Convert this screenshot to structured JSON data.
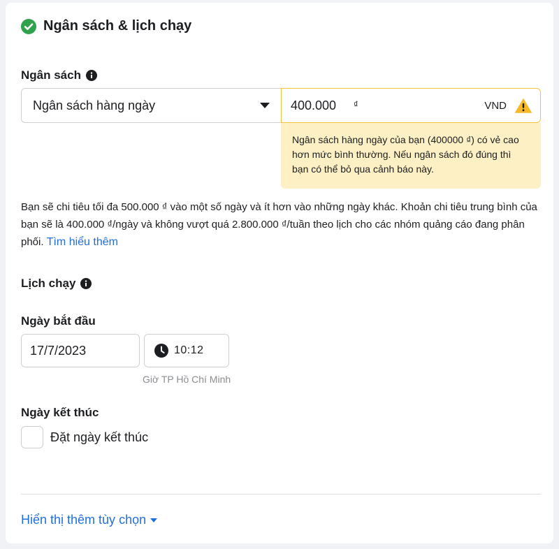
{
  "header": {
    "title": "Ngân sách & lịch chạy"
  },
  "budget": {
    "label": "Ngân sách",
    "type_selected": "Ngân sách hàng ngày",
    "amount_value": "400.000",
    "currency_symbol": "₫",
    "currency_code": "VND",
    "warning_text": "Ngân sách hàng ngày của bạn (400000 ₫) có vẻ cao hơn mức bình thường. Nếu ngân sách đó đúng thì bạn có thể bỏ qua cảnh báo này.",
    "description": "Bạn sẽ chi tiêu tối đa 500.000 ₫ vào một số ngày và ít hơn vào những ngày khác. Khoản chi tiêu trung bình của bạn sẽ là 400.000 ₫/ngày và không vượt quá 2.800.000 ₫/tuần theo lịch cho các nhóm quảng cáo đang phân phối.",
    "learn_more": "Tìm hiểu thêm"
  },
  "schedule": {
    "label": "Lịch chạy",
    "start_label": "Ngày bắt đầu",
    "start_date": "17/7/2023",
    "start_time": "10:12",
    "timezone": "Giờ TP Hồ Chí Minh",
    "end_label": "Ngày kết thúc",
    "end_checkbox_label": "Đặt ngày kết thúc",
    "end_checked": false
  },
  "footer": {
    "more_options": "Hiển thị thêm tùy chọn"
  },
  "icons": {
    "header_status": "check-circle-icon",
    "info": "info-icon",
    "dropdown": "caret-down-icon",
    "warning": "warning-triangle-icon",
    "time": "clock-icon"
  },
  "colors": {
    "accent_link": "#216fdb",
    "success": "#31a24c",
    "warning_border": "#f0c33c",
    "warning_bg": "#fdf0c4",
    "warning_icon": "#f7b928"
  }
}
